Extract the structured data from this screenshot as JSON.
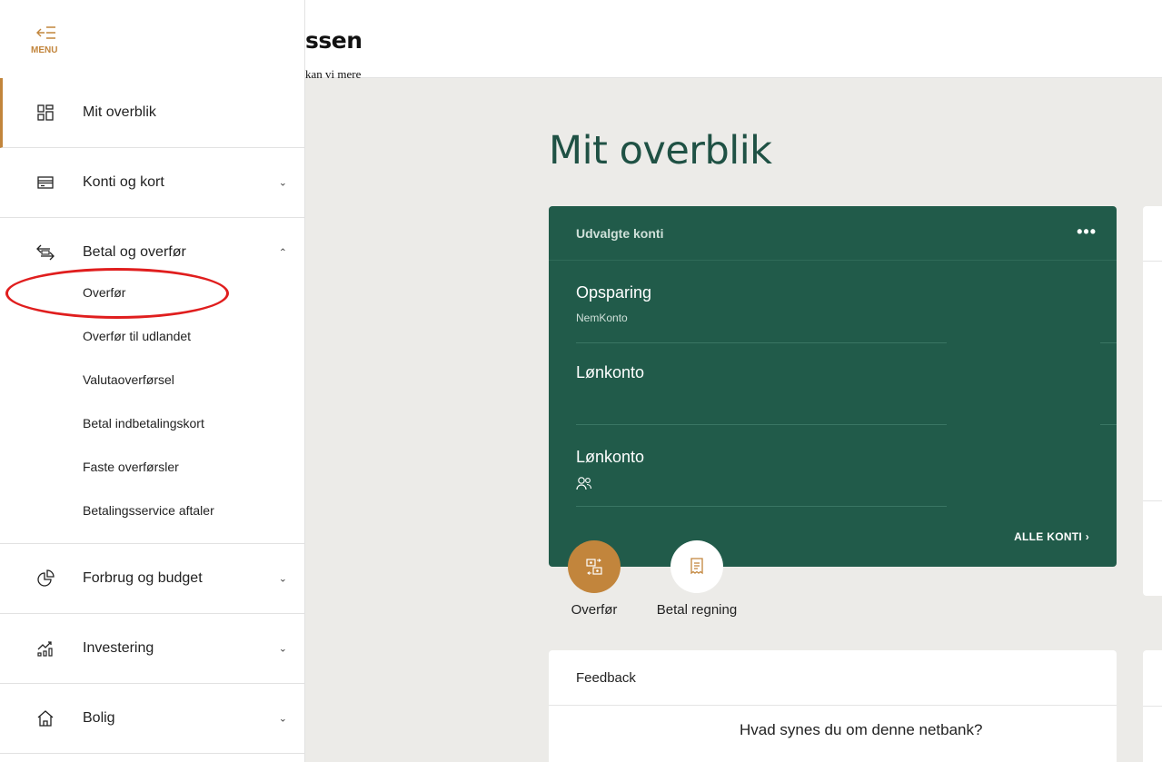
{
  "brand": {
    "wordmark": "ssen",
    "tagline": "kan vi mere"
  },
  "menu": {
    "label": "MENU",
    "icon": "menu-collapse-icon"
  },
  "sidebar": {
    "items": [
      {
        "label": "Mit overblik",
        "icon": "dashboard-grid-icon",
        "active": true
      },
      {
        "label": "Konti og kort",
        "icon": "card-icon",
        "expanded": false
      },
      {
        "label": "Betal og overfør",
        "icon": "transfer-arrows-icon",
        "expanded": true,
        "children": [
          "Overfør",
          "Overfør til udlandet",
          "Valutaoverførsel",
          "Betal indbetalingskort",
          "Faste overførsler",
          "Betalingsservice aftaler"
        ]
      },
      {
        "label": "Forbrug og budget",
        "icon": "pie-chart-icon",
        "expanded": false
      },
      {
        "label": "Investering",
        "icon": "investment-chart-icon",
        "expanded": false
      },
      {
        "label": "Bolig",
        "icon": "house-icon",
        "expanded": false
      }
    ]
  },
  "main": {
    "title": "Mit overblik",
    "accounts_card": {
      "title": "Udvalgte konti",
      "more": "•••",
      "accounts": [
        {
          "name": "Opsparing",
          "sub": "NemKonto"
        },
        {
          "name": "Lønkonto",
          "sub": ""
        },
        {
          "name": "Lønkonto",
          "sub_icon": "shared-users-icon"
        }
      ],
      "all_link": "ALLE KONTI ›"
    },
    "actions": [
      {
        "label": "Overfør",
        "icon": "transfer-money-icon"
      },
      {
        "label": "Betal regning",
        "icon": "bill-receipt-icon"
      }
    ],
    "feedback": {
      "title": "Feedback",
      "question": "Hvad synes du om denne netbank?"
    }
  },
  "colors": {
    "accent": "#c2853c",
    "card_green": "#215b4a",
    "title_green": "#1f5144",
    "annotation_red": "#e01e1e"
  }
}
